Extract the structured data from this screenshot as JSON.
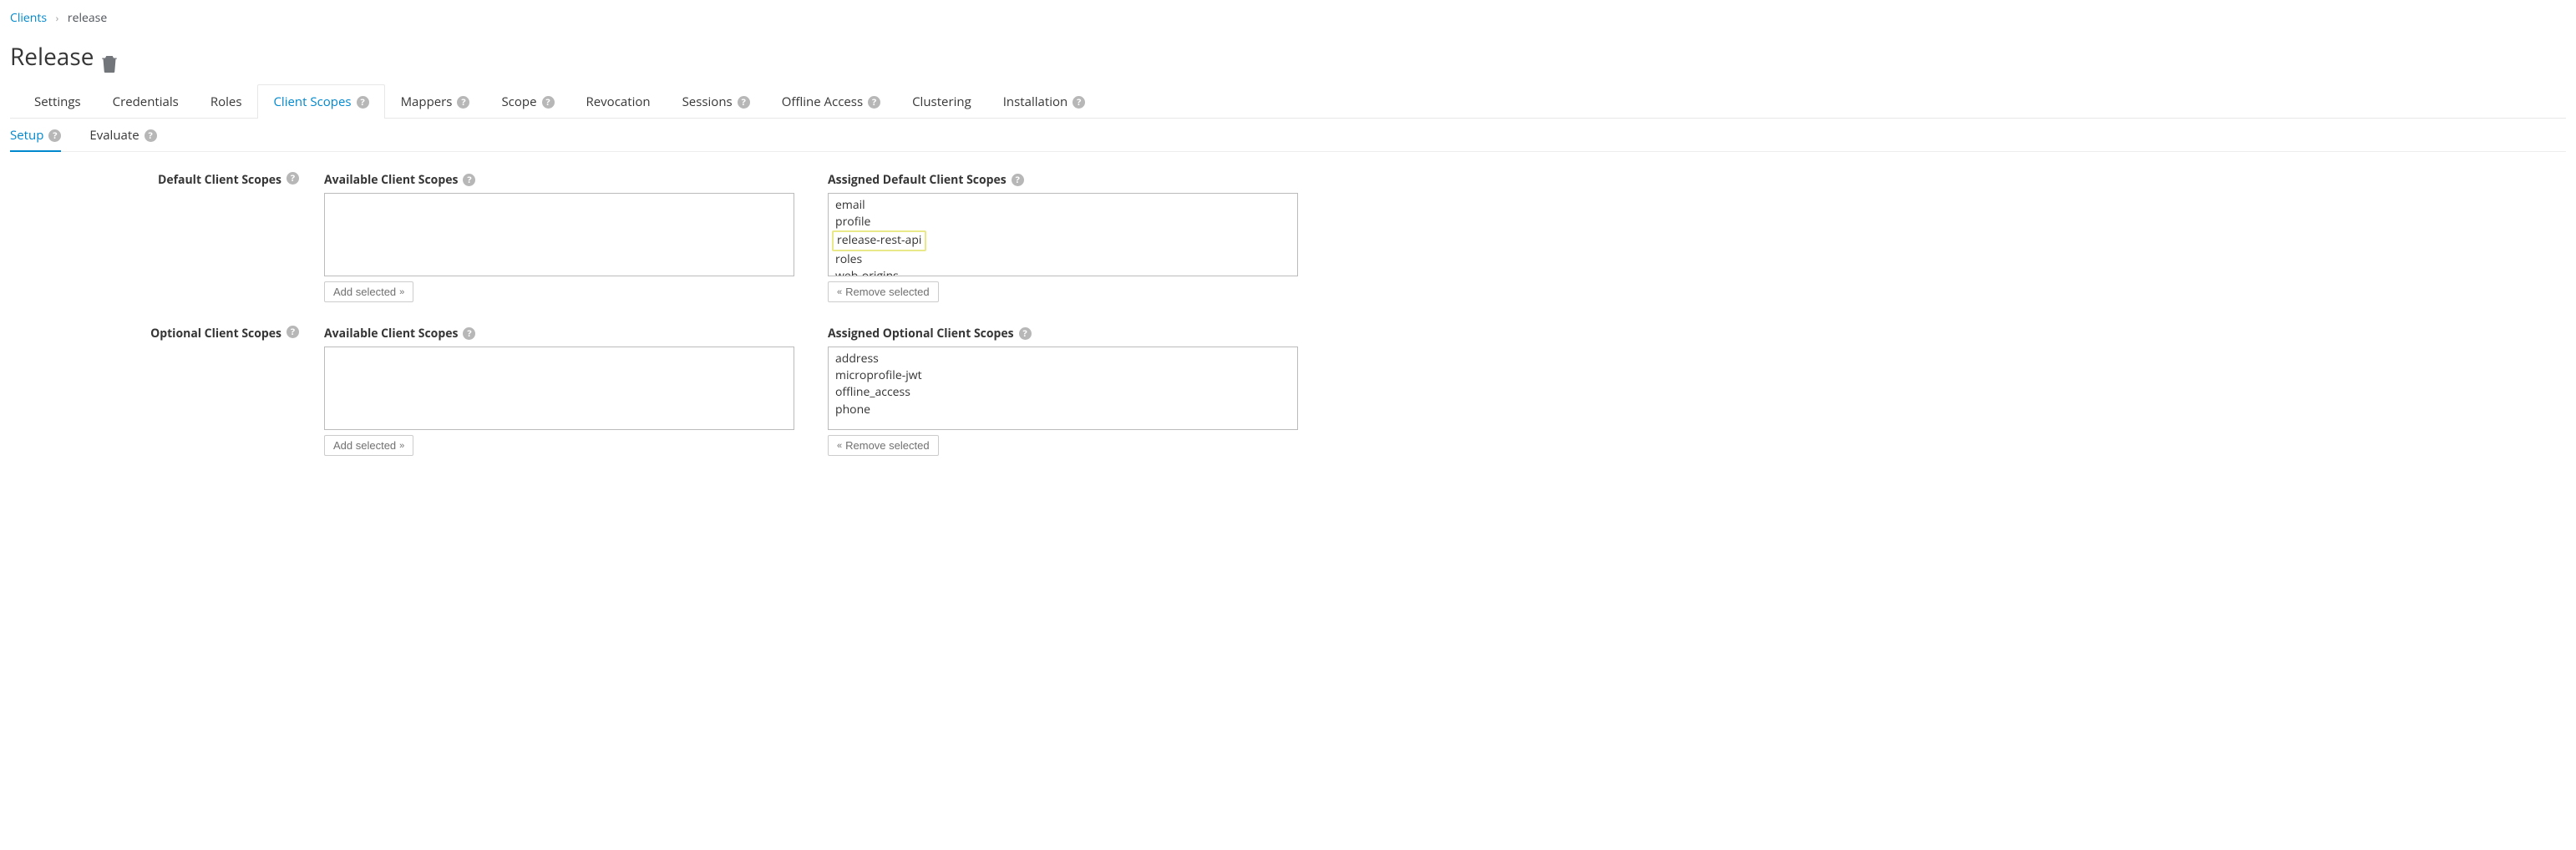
{
  "breadcrumb": {
    "root": "Clients",
    "current": "release"
  },
  "page_title": "Release ",
  "tabs": [
    {
      "label": "Settings",
      "help": false
    },
    {
      "label": "Credentials",
      "help": false
    },
    {
      "label": "Roles",
      "help": false
    },
    {
      "label": "Client Scopes",
      "help": true,
      "active": true
    },
    {
      "label": "Mappers",
      "help": true
    },
    {
      "label": "Scope",
      "help": true
    },
    {
      "label": "Revocation",
      "help": false
    },
    {
      "label": "Sessions",
      "help": true
    },
    {
      "label": "Offline Access",
      "help": true
    },
    {
      "label": "Clustering",
      "help": false
    },
    {
      "label": "Installation",
      "help": true
    }
  ],
  "subtabs": [
    {
      "label": "Setup",
      "help": true,
      "active": true
    },
    {
      "label": "Evaluate",
      "help": true
    }
  ],
  "sections": [
    {
      "row_label": "Default Client Scopes",
      "available": {
        "label": "Available Client Scopes",
        "items": [],
        "button": "Add selected"
      },
      "assigned": {
        "label": "Assigned Default Client Scopes",
        "items": [
          {
            "text": "email"
          },
          {
            "text": "profile"
          },
          {
            "text": "release-rest-api",
            "highlight": true
          },
          {
            "text": "roles"
          },
          {
            "text": "web-origins"
          }
        ],
        "button": "Remove selected"
      }
    },
    {
      "row_label": "Optional Client Scopes",
      "available": {
        "label": "Available Client Scopes",
        "items": [],
        "button": "Add selected"
      },
      "assigned": {
        "label": "Assigned Optional Client Scopes",
        "items": [
          {
            "text": "address"
          },
          {
            "text": "microprofile-jwt"
          },
          {
            "text": "offline_access"
          },
          {
            "text": "phone"
          }
        ],
        "button": "Remove selected"
      }
    }
  ]
}
